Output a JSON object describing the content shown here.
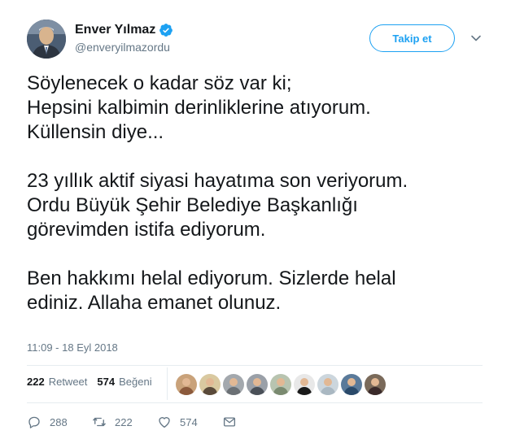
{
  "author": {
    "name": "Enver Yılmaz",
    "handle": "@enveryilmazordu",
    "verified": true,
    "follow_label": "Takip et"
  },
  "tweet": {
    "paragraphs": [
      [
        "Söylenecek o kadar söz var ki;",
        "Hepsini kalbimin derinliklerine atıyorum.",
        "Küllensin diye..."
      ],
      [
        "23 yıllık aktif siyasi hayatıma son veriyorum.",
        "Ordu Büyük Şehir Belediye Başkanlığı",
        "görevimden istifa ediyorum."
      ],
      [
        "Ben hakkımı helal ediyorum. Sizlerde helal",
        "ediniz. Allaha emanet olunuz."
      ]
    ],
    "timestamp": "11:09 - 18 Eyl 2018"
  },
  "stats": {
    "retweets_count": "222",
    "retweets_label": "Retweet",
    "likes_count": "574",
    "likes_label": "Beğeni"
  },
  "likers": [
    {
      "bg": "#c9a27a",
      "shirt": "#8c5a3c"
    },
    {
      "bg": "#d9c9a0",
      "shirt": "#5a4a3a"
    },
    {
      "bg": "#a3a8ad",
      "shirt": "#6b7075"
    },
    {
      "bg": "#9aa0a8",
      "shirt": "#4a5058"
    },
    {
      "bg": "#b8c4b0",
      "shirt": "#7a8a70"
    },
    {
      "bg": "#e8e8e8",
      "shirt": "#1a1a1a"
    },
    {
      "bg": "#ccd6dd",
      "shirt": "#aab8c2"
    },
    {
      "bg": "#5a7a9a",
      "shirt": "#2a4a6a"
    },
    {
      "bg": "#7a6a5a",
      "shirt": "#3a2a2a"
    }
  ],
  "actions": {
    "reply_count": "288",
    "retweet_count": "222",
    "like_count": "574"
  },
  "colors": {
    "accent": "#1da1f2",
    "text": "#14171a",
    "muted": "#657786",
    "divider": "#e6ecf0"
  }
}
